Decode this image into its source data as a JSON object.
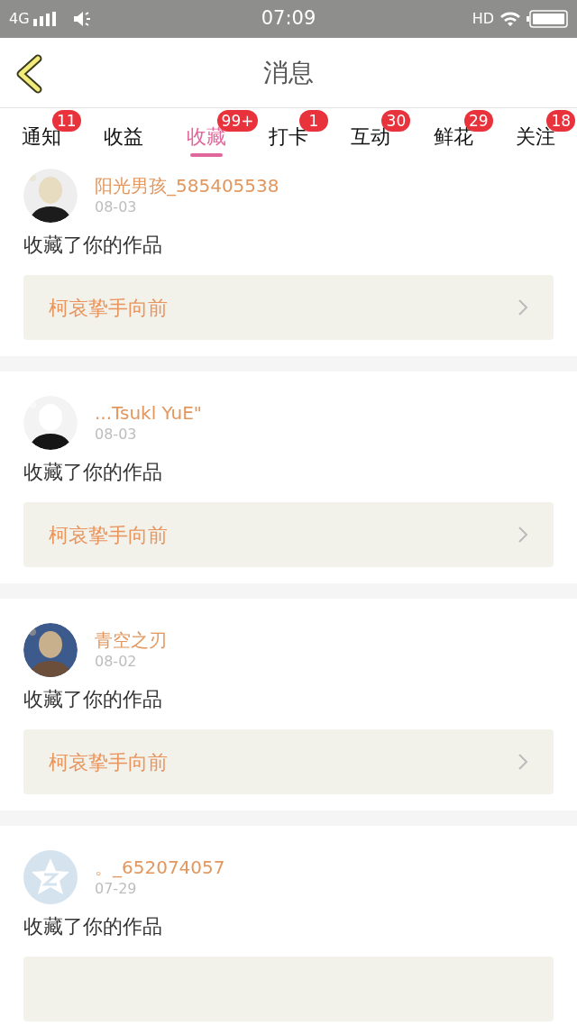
{
  "status_bar": {
    "network": "4G",
    "time": "07:09",
    "hd": "HD"
  },
  "header": {
    "title": "消息"
  },
  "tabs": [
    {
      "label": "通知",
      "badge": "11",
      "selected": false
    },
    {
      "label": "收益",
      "selected": false
    },
    {
      "label": "收藏",
      "badge": "99+",
      "selected": true
    },
    {
      "label": "打卡",
      "badge": "1",
      "selected": false
    },
    {
      "label": "互动",
      "badge": "30",
      "selected": false
    },
    {
      "label": "鲜花",
      "badge": "29",
      "selected": false
    },
    {
      "label": "关注",
      "badge": "18",
      "selected": false
    }
  ],
  "messages": [
    {
      "name": "阳光男孩_585405538",
      "date": "08-03",
      "action": "收藏了你的作品",
      "work": "柯哀挚手向前"
    },
    {
      "name": "...Tsukl YuE\"",
      "date": "08-03",
      "action": "收藏了你的作品",
      "work": "柯哀挚手向前"
    },
    {
      "name": "青空之刃",
      "date": "08-02",
      "action": "收藏了你的作品",
      "work": "柯哀挚手向前"
    },
    {
      "avatar": {
        "kind": "default"
      },
      "name": "。_652074057",
      "date": "07-29",
      "action": "收藏了你的作品"
    }
  ]
}
